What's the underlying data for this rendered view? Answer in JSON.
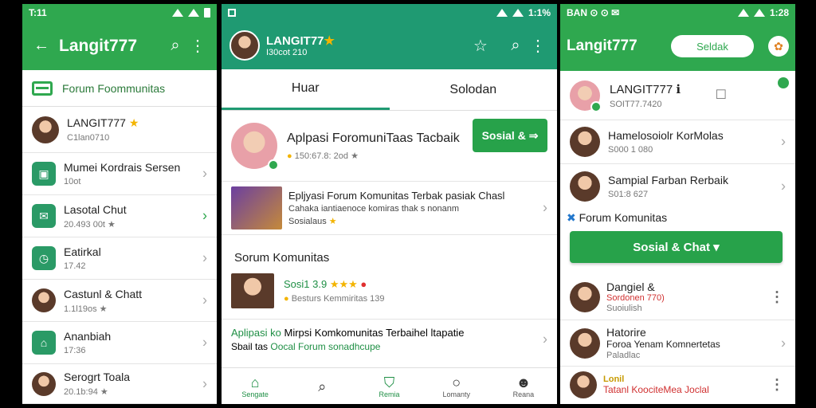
{
  "s1": {
    "status_time": "T:11",
    "title": "Langit777",
    "section": "Forum Foommunitas",
    "profile": {
      "name": "LANGIT777",
      "sub": "C1lan0710"
    },
    "items": [
      {
        "t": "Mumei Kordrais Sersen",
        "s": "10ot"
      },
      {
        "t": "Lasotal Chut",
        "s": "20.493 00t ★"
      },
      {
        "t": "Eatirkal",
        "s": "17.42"
      },
      {
        "t": "Castunl & Chatt",
        "s": "1.1l19os ★"
      },
      {
        "t": "Ananbiah",
        "s": "17:36"
      },
      {
        "t": "Serogrt Toala",
        "s": "20.1b:94 ★"
      }
    ]
  },
  "s2": {
    "status_right": "1:1%",
    "title": "LANGIT77",
    "sub": "I30cot 210",
    "tabs": [
      "Huar",
      "Solodan"
    ],
    "feature": {
      "title": "Aplpasi ForomuniTaas Tacbaik",
      "meta": "150:67.8: 2od",
      "button": "Sosial &"
    },
    "item1": {
      "t": "Epljyasi Forum Komunitas Terbak pasiak Chasl",
      "s": "Cahaka iantiaenoce komiras thak s nonanm",
      "s2": "Sosialaus"
    },
    "section": "Sorum Komunitas",
    "item2": {
      "t": "Sosi1 3.9",
      "s": "Besturs Kemmiritas 139"
    },
    "item3": {
      "t1": "Aplipasi ko",
      "t2": "Mirpsi Komkomunitas Terbaihel ltapatie",
      "s1": "Sbail tas",
      "s2": "Oocal Forum sonadhcupe"
    },
    "nav": [
      "Sengate",
      "",
      "Remia",
      "Lomanty",
      "Reana"
    ]
  },
  "s3": {
    "status_left": "BAN",
    "status_time": "1:28",
    "title": "Langit777",
    "search": "Seldak",
    "profile": {
      "name": "LANGIT777",
      "sub": "SOIT77.7420"
    },
    "items": [
      {
        "t": "Hamelosoiolr KorMolas",
        "s": "S000 1 080"
      },
      {
        "t": "Sampial Farban Rerbaik",
        "s": "S01:8 627"
      }
    ],
    "section": "Forum Komunitas",
    "button": "Sosial & Chat",
    "list": [
      {
        "t": "Dangiel &",
        "s": "Sordonen 770)",
        "s2": "Suoiulish"
      },
      {
        "t": "Hatorire",
        "s": "Foroa Yenam Komnertetas",
        "s2": "Paladlac"
      },
      {
        "t": "Lonil",
        "s": "Tatanl KoociteMea Joclal"
      }
    ]
  }
}
